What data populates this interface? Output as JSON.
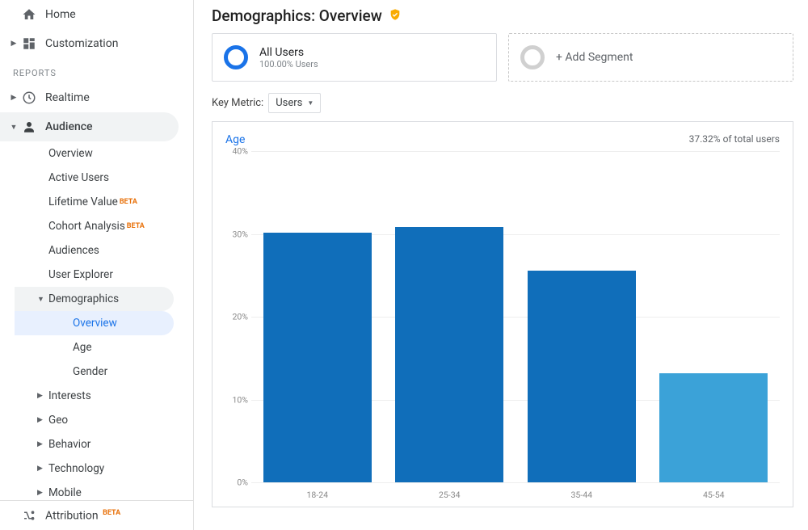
{
  "sidebar": {
    "home": "Home",
    "customization": "Customization",
    "reports_header": "REPORTS",
    "realtime": "Realtime",
    "audience": "Audience",
    "audience_children": {
      "overview": "Overview",
      "active_users": "Active Users",
      "lifetime_value": "Lifetime Value",
      "cohort": "Cohort Analysis",
      "audiences": "Audiences",
      "user_explorer": "User Explorer",
      "demographics": "Demographics",
      "demographics_children": {
        "overview": "Overview",
        "age": "Age",
        "gender": "Gender"
      },
      "interests": "Interests",
      "geo": "Geo",
      "behavior": "Behavior",
      "technology": "Technology",
      "mobile": "Mobile"
    },
    "attribution": "Attribution",
    "beta_tag": "BETA"
  },
  "header": {
    "title": "Demographics: Overview"
  },
  "segments": {
    "all_users": {
      "title": "All Users",
      "subtitle": "100.00% Users"
    },
    "add": "+ Add Segment"
  },
  "key_metric": {
    "label": "Key Metric:",
    "value": "Users"
  },
  "chart_header": {
    "title": "Age",
    "note": "37.32% of total users"
  },
  "chart_data": {
    "type": "bar",
    "categories": [
      "18-24",
      "25-34",
      "35-44",
      "45-54"
    ],
    "values": [
      30.1,
      30.8,
      25.6,
      13.2
    ],
    "y_ticks": [
      0,
      10,
      20,
      30,
      40
    ],
    "ylim": [
      0,
      40
    ],
    "ylabel_suffix": "%",
    "light_bars": [
      3
    ]
  }
}
